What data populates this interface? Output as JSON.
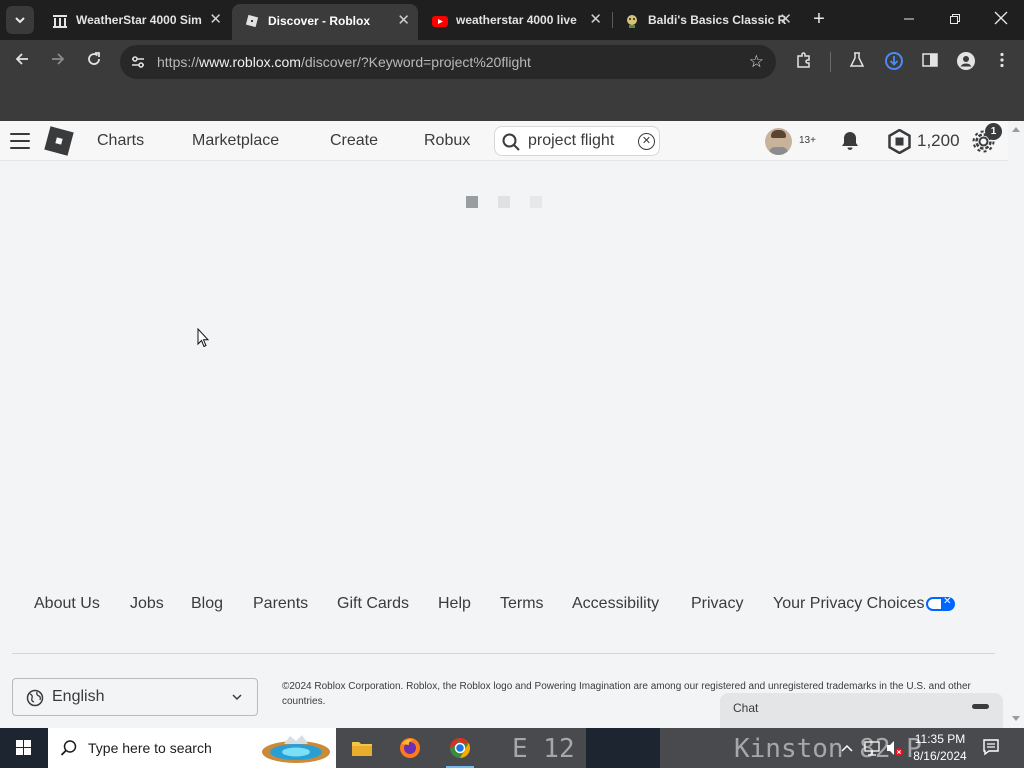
{
  "browser": {
    "tabs": [
      {
        "title": "WeatherStar 4000 Sim",
        "favicon": "columns-icon",
        "active": false
      },
      {
        "title": "Discover - Roblox",
        "favicon": "roblox-icon",
        "active": true
      },
      {
        "title": "weatherstar 4000 live",
        "favicon": "youtube-icon",
        "active": false
      },
      {
        "title": "Baldi's Basics Classic R",
        "favicon": "baldi-icon",
        "active": false
      }
    ],
    "new_tab": "+",
    "url_prefix": "https://",
    "url_domain": "www.roblox.com",
    "url_path": "/discover/?Keyword=project%20flight"
  },
  "roblox": {
    "nav": {
      "charts": "Charts",
      "marketplace": "Marketplace",
      "create": "Create",
      "robux": "Robux"
    },
    "search_value": "project flight",
    "age_badge": "13+",
    "robux_balance": "1,200",
    "settings_badge": "1",
    "loader_dots": 3
  },
  "footer": {
    "links": [
      "About Us",
      "Jobs",
      "Blog",
      "Parents",
      "Gift Cards",
      "Help",
      "Terms",
      "Accessibility",
      "Privacy",
      "Your Privacy Choices"
    ],
    "language": "English",
    "copyright": "©2024 Roblox Corporation. Roblox, the Roblox logo and Powering Imagination are among our registered and unregistered trademarks in the U.S. and other countries."
  },
  "chat": {
    "title": "Chat"
  },
  "taskbar": {
    "search_placeholder": "Type here to search",
    "wallpaper_text_1": "E  12",
    "wallpaper_text_2": "Kinston  82 P",
    "time": "11:35 PM",
    "date": "8/16/2024"
  },
  "colors": {
    "roblox_text": "#393b3d",
    "page_bg": "#f2f4f5",
    "browser_dark": "#1f1f1f",
    "browser_toolbar": "#3b3b3b",
    "privacy_toggle": "#0066ff"
  }
}
